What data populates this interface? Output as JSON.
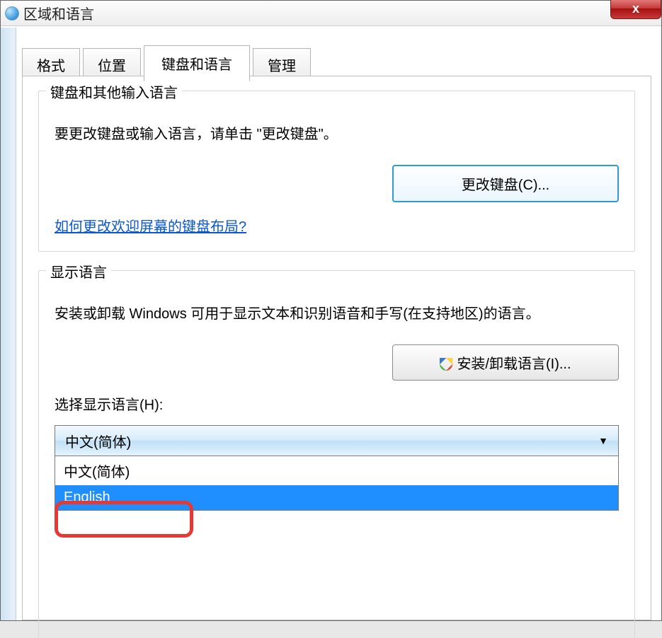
{
  "window": {
    "title": "区域和语言",
    "close_glyph": "x"
  },
  "tabs": [
    {
      "label": "格式"
    },
    {
      "label": "位置"
    },
    {
      "label": "键盘和语言"
    },
    {
      "label": "管理"
    }
  ],
  "group_keyboard": {
    "legend": "键盘和其他输入语言",
    "desc": "要更改键盘或输入语言，请单击 \"更改键盘\"。",
    "change_btn": "更改键盘(C)...",
    "link": "如何更改欢迎屏幕的键盘布局?"
  },
  "group_display": {
    "legend": "显示语言",
    "desc": "安装或卸载 Windows 可用于显示文本和识别语音和手写(在支持地区)的语言。",
    "install_btn": "安装/卸载语言(I)...",
    "select_label": "选择显示语言(H):",
    "selected": "中文(简体)",
    "options": [
      "中文(简体)",
      "English"
    ]
  }
}
